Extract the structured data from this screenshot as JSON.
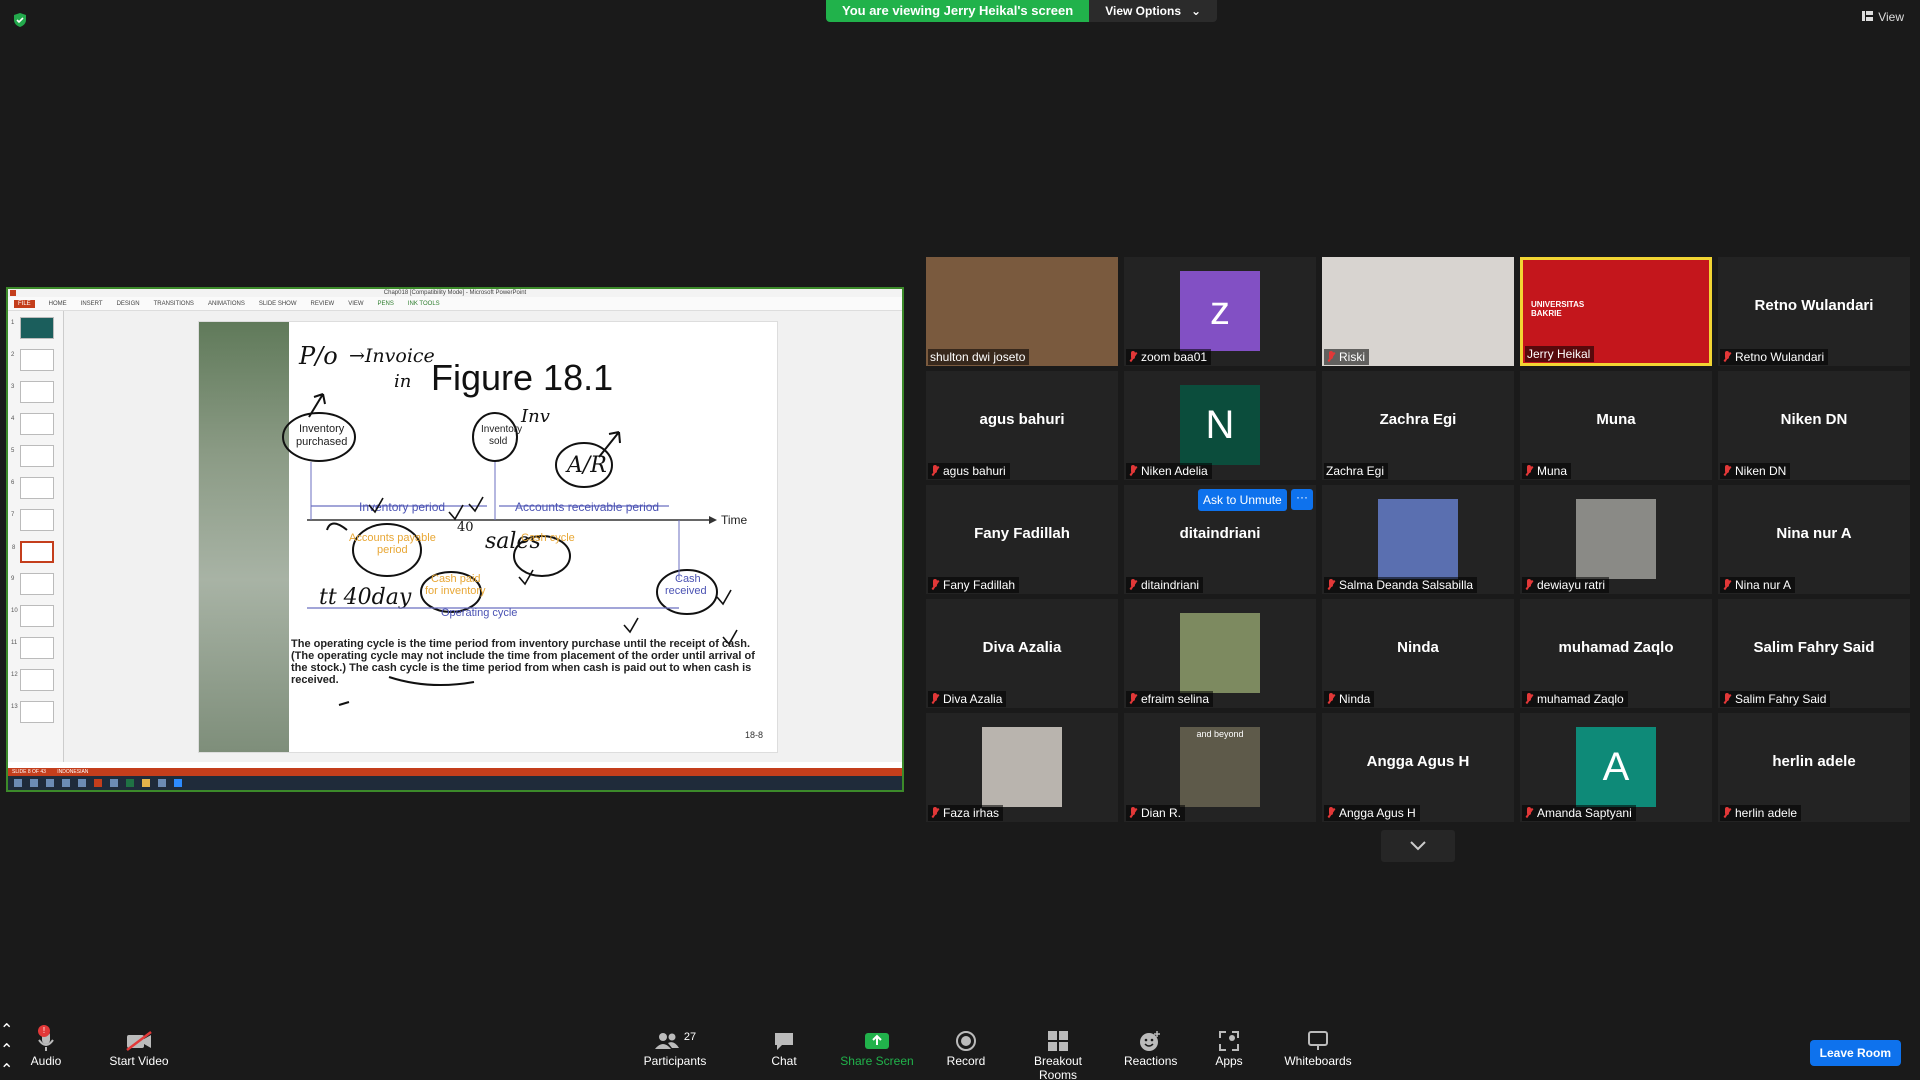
{
  "banner": {
    "viewing_text": "You are viewing Jerry Heikal's screen",
    "view_options": "View Options"
  },
  "top_right": {
    "view": "View"
  },
  "shared_screen": {
    "ppt_title": "Chap018 [Compatibility Mode] - Microsoft PowerPoint",
    "tabs": [
      "FILE",
      "HOME",
      "INSERT",
      "DESIGN",
      "TRANSITIONS",
      "ANIMATIONS",
      "SLIDE SHOW",
      "REVIEW",
      "VIEW",
      "PENS"
    ],
    "ink_tools": "INK TOOLS",
    "slide_numbers": [
      "1",
      "2",
      "3",
      "4",
      "5",
      "6",
      "7",
      "8",
      "9",
      "10",
      "11",
      "12",
      "13"
    ],
    "status_left": "SLIDE 8 OF 43",
    "status_lang": "INDONESIAN",
    "slide": {
      "title": "Figure 18.1",
      "page": "18-8",
      "inventory_purchased": "Inventory purchased",
      "inventory_sold": "Inventory sold",
      "inventory_period": "Inventory period",
      "ar_period": "Accounts receivable period",
      "time": "Time",
      "ap_period": "Accounts payable period",
      "cash_cycle": "Cash cycle",
      "cash_paid": "Cash paid for inventory",
      "cash_received": "Cash received",
      "operating_cycle": "Operating cycle",
      "body": "The operating cycle is the time period from inventory purchase until the receipt of cash. (The operating cycle may not include the time from placement of the order until arrival of the stock.) The cash cycle is the time period from when cash is paid out to when cash is received.",
      "ink": {
        "po": "P/o",
        "invoice": "→Invoice",
        "in": "in",
        "inv": "Inv",
        "ar": "A/R",
        "forty": "40",
        "sales": "sales",
        "tt": "tt 40day"
      }
    }
  },
  "participants": [
    {
      "name": "shulton dwi joseto",
      "muted": false,
      "kind": "video",
      "color": "#7a5a3e"
    },
    {
      "name": "zoom baa01",
      "muted": true,
      "kind": "letter",
      "letter": "z",
      "color": "#8250c4"
    },
    {
      "name": "Riski",
      "muted": true,
      "kind": "video",
      "color": "#d8d4d0"
    },
    {
      "name": "Jerry Heikal",
      "muted": false,
      "kind": "video",
      "color": "#c4161c",
      "active": true,
      "sub": "UNIVERSITAS BAKRIE"
    },
    {
      "name": "Retno Wulandari",
      "muted": true,
      "kind": "name"
    },
    {
      "name": "agus bahuri",
      "muted": true,
      "kind": "name"
    },
    {
      "name": "Niken Adelia",
      "muted": true,
      "kind": "letter",
      "letter": "N",
      "color": "#0b4d3c"
    },
    {
      "name": "Zachra Egi",
      "muted": false,
      "kind": "name"
    },
    {
      "name": "Muna",
      "muted": true,
      "kind": "name"
    },
    {
      "name": "Niken DN",
      "muted": true,
      "kind": "name"
    },
    {
      "name": "Fany Fadillah",
      "muted": true,
      "kind": "name"
    },
    {
      "name": "ditaindriani",
      "muted": true,
      "kind": "name"
    },
    {
      "name": "Salma Deanda Salsabilla",
      "muted": true,
      "kind": "photo",
      "color": "#5a6fb0"
    },
    {
      "name": "dewiayu ratri",
      "muted": true,
      "kind": "photo",
      "color": "#8a8a86"
    },
    {
      "name": "Nina nur A",
      "muted": true,
      "kind": "name"
    },
    {
      "name": "Diva Azalia",
      "muted": true,
      "kind": "name"
    },
    {
      "name": "efraim selina",
      "muted": true,
      "kind": "photo",
      "color": "#7d8a60"
    },
    {
      "name": "Ninda",
      "muted": true,
      "kind": "name"
    },
    {
      "name": "muhamad Zaqlo",
      "muted": true,
      "kind": "name"
    },
    {
      "name": "Salim Fahry Said",
      "muted": true,
      "kind": "name"
    },
    {
      "name": "Faza irhas",
      "muted": true,
      "kind": "photo",
      "color": "#b9b4ae"
    },
    {
      "name": "Dian R.",
      "muted": true,
      "kind": "photo",
      "color": "#5e5a4a",
      "photo_text": "and beyond"
    },
    {
      "name": "Angga Agus H",
      "muted": true,
      "kind": "name"
    },
    {
      "name": "Amanda Saptyani",
      "muted": true,
      "kind": "letter",
      "letter": "A",
      "color": "#0e8a78"
    },
    {
      "name": "herlin adele",
      "muted": true,
      "kind": "name"
    }
  ],
  "ask_to_unmute": "Ask to Unmute",
  "more": "···",
  "toolbar": {
    "audio": "Audio",
    "start_video": "Start Video",
    "participants": "Participants",
    "participants_count": "27",
    "chat": "Chat",
    "share_screen": "Share Screen",
    "record": "Record",
    "breakout_rooms": "Breakout Rooms",
    "reactions": "Reactions",
    "apps": "Apps",
    "whiteboards": "Whiteboards",
    "leave_room": "Leave Room"
  }
}
